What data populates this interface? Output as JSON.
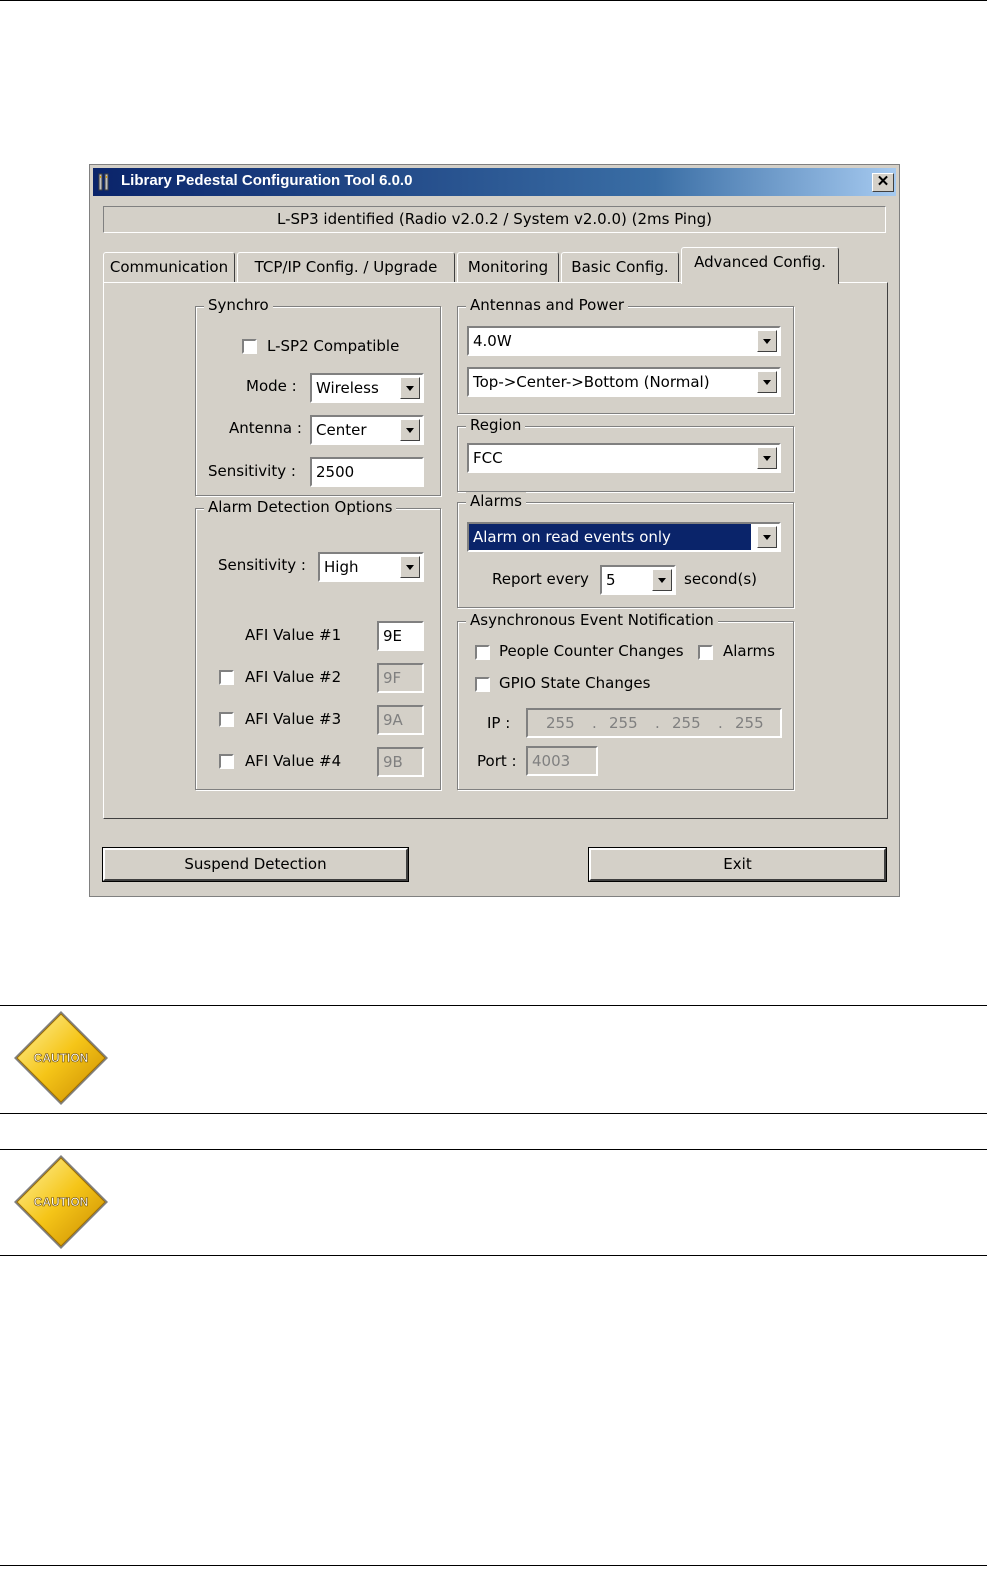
{
  "window": {
    "title": "Library Pedestal Configuration Tool 6.0.0",
    "close_label": "✕",
    "status": "L-SP3 identified (Radio v2.0.2 / System v2.0.0) (2ms Ping)"
  },
  "tabs": [
    {
      "label": "Communication"
    },
    {
      "label": "TCP/IP Config. / Upgrade"
    },
    {
      "label": "Monitoring"
    },
    {
      "label": "Basic Config."
    },
    {
      "label": "Advanced Config."
    }
  ],
  "synchro": {
    "legend": "Synchro",
    "lsp2_label": "L-SP2 Compatible",
    "mode_label": "Mode :",
    "mode_value": "Wireless",
    "antenna_label": "Antenna :",
    "antenna_value": "Center",
    "sensitivity_label": "Sensitivity :",
    "sensitivity_value": "2500"
  },
  "alarm_detection": {
    "legend": "Alarm Detection Options",
    "sensitivity_label": "Sensitivity :",
    "sensitivity_value": "High",
    "afi": [
      {
        "label": "AFI Value #1",
        "value": "9E"
      },
      {
        "label": "AFI Value #2",
        "value": "9F"
      },
      {
        "label": "AFI Value #3",
        "value": "9A"
      },
      {
        "label": "AFI Value #4",
        "value": "9B"
      }
    ]
  },
  "antennas_power": {
    "legend": "Antennas and Power",
    "power_value": "4.0W",
    "sequence_value": "Top->Center->Bottom (Normal)"
  },
  "region": {
    "legend": "Region",
    "value": "FCC"
  },
  "alarms": {
    "legend": "Alarms",
    "mode_value": "Alarm on read events only",
    "report_label": "Report every",
    "report_value": "5",
    "report_unit": "second(s)"
  },
  "async": {
    "legend": "Asynchronous Event Notification",
    "people_counter_label": "People Counter Changes",
    "alarms_label": "Alarms",
    "gpio_label": "GPIO State Changes",
    "ip_label": "IP :",
    "ip": [
      "255",
      "255",
      "255",
      "255"
    ],
    "ip_dot": ".",
    "port_label": "Port :",
    "port_value": "4003"
  },
  "buttons": {
    "suspend": "Suspend Detection",
    "exit": "Exit"
  },
  "caution_text": "CAUTION",
  "colors": {
    "title_start": "#0a246a",
    "title_end": "#a6caf0",
    "face": "#d4d0c8",
    "selection": "#0a246a",
    "caution_fill": "#f5c518"
  }
}
